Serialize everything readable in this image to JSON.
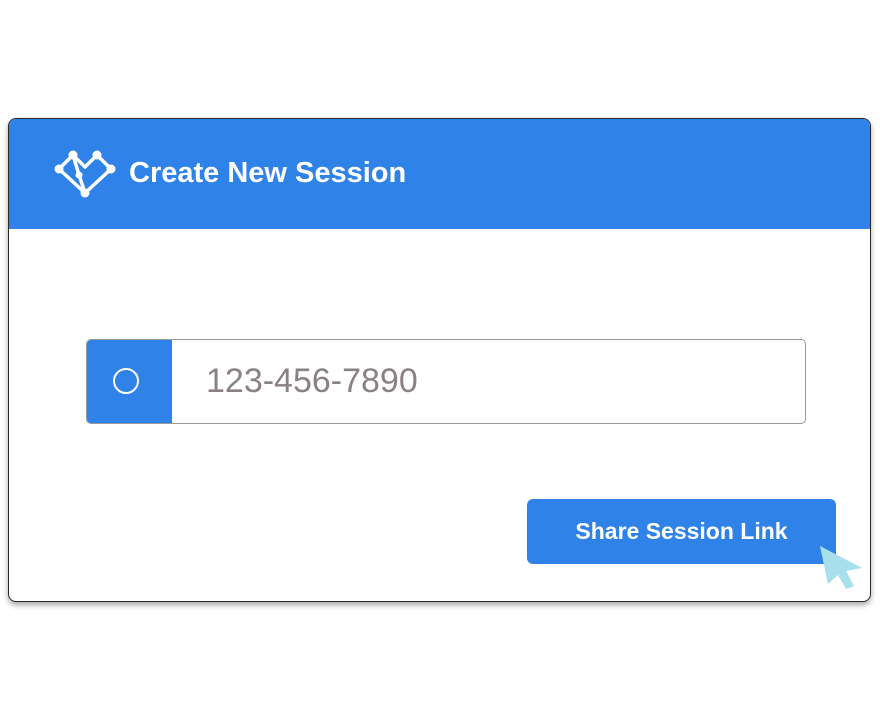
{
  "dialog": {
    "title": "Create New Session",
    "logo_icon": "heart-network-icon"
  },
  "phone_field": {
    "prefix_icon": "radio-circle-icon",
    "value": "",
    "placeholder": "123-456-7890"
  },
  "actions": {
    "share_label": "Share Session Link"
  },
  "cursor": {
    "icon": "pointer-cursor-icon"
  },
  "colors": {
    "accent": "#2f82e8",
    "placeholder_text": "#8a8282",
    "cursor": "#a8dfec"
  }
}
